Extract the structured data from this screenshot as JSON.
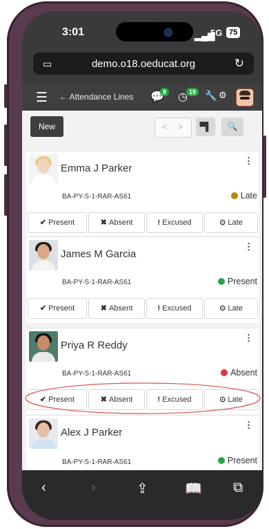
{
  "status_bar": {
    "time": "3:01",
    "network": "5G",
    "battery": "75"
  },
  "browser": {
    "url": "demo.o18.oeducat.org"
  },
  "app_nav": {
    "title": "← Attendance Lines",
    "messages_count": "8",
    "activity_count": "19"
  },
  "toolbar": {
    "new_label": "New"
  },
  "records": [
    {
      "name": "Emma J Parker",
      "code": "BA-PY-S-1-RAR-AS61",
      "status": "Late",
      "status_color": "#b8860b",
      "photo_bg": "#f3f3f3",
      "hair": "#e8c98b",
      "skin": "#f2d3bf",
      "body": "#ffffff"
    },
    {
      "name": "James M Garcia",
      "code": "BA-PY-S-1-RAR-AS61",
      "status": "Present",
      "status_color": "#28a745",
      "photo_bg": "#dde0e4",
      "hair": "#2a1d14",
      "skin": "#d9a886",
      "body": "#f4f4f4"
    },
    {
      "name": "Priya R Reddy",
      "code": "BA-PY-S-1-RAR-AS61",
      "status": "Absent",
      "status_color": "#dc3545",
      "photo_bg": "#4e7b6a",
      "hair": "#1a120d",
      "skin": "#c78d68",
      "body": "#e9e9e9"
    },
    {
      "name": "Alex J Parker",
      "code": "BA-PY-S-1-RAR-AS61",
      "status": "Present",
      "status_color": "#28a745",
      "photo_bg": "#e7eaee",
      "hair": "#3a2618",
      "skin": "#e7c0a3",
      "body": "#cfe3f2"
    }
  ],
  "actions": {
    "present": "Present",
    "absent": "Absent",
    "excused": "Excused",
    "late": "Late"
  },
  "icons": {
    "menu": "hamburger-icon",
    "chat": "chat-icon",
    "clock": "clock-icon",
    "wrench": "wrench-icon",
    "settings": "gears-icon",
    "kebab": "kebab-icon",
    "check": "check-icon",
    "cross": "cross-icon",
    "exclaim": "exclamation-icon",
    "late": "clock-icon",
    "share": "share-icon",
    "bookmarks": "book-icon",
    "tabs": "tabs-icon"
  }
}
